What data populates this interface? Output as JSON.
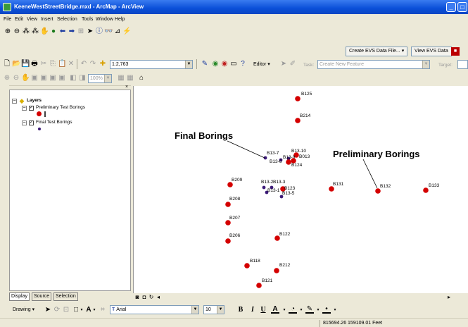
{
  "window": {
    "title": "KeeneWestStreetBridge.mxd - ArcMap - ArcView"
  },
  "menu": [
    "File",
    "Edit",
    "View",
    "Insert",
    "Selection",
    "Tools",
    "Window",
    "Help"
  ],
  "toolbar": {
    "scale": "1:2,763",
    "editor_label": "Editor",
    "task_label": "Task:",
    "task_value": "Create New Feature",
    "target_label": "Target:",
    "zoom_value": "100%",
    "create_evs_label": "Create EVS Data File...",
    "view_evs_label": "View EVS Data"
  },
  "toc": {
    "root_label": "Layers",
    "layers": [
      {
        "name": "Preliminary Test Borings",
        "checked": true,
        "color": "#cc0000"
      },
      {
        "name": "Final Test Borings",
        "checked": true,
        "color": "#3c1a78"
      }
    ]
  },
  "tabs": [
    "Display",
    "Source",
    "Selection"
  ],
  "map": {
    "annotations": {
      "final": "Final Borings",
      "preliminary": "Preliminary Borings"
    },
    "preliminary_color": "#d40000",
    "final_color": "#3c1a78",
    "borings": [
      "B125",
      "B214",
      "B13-7",
      "B13-10",
      "B13-6",
      "B13-9",
      "B013",
      "B124",
      "B209",
      "B13-2",
      "B13-3",
      "B13-1",
      "B123",
      "B13-5",
      "B131",
      "B132",
      "B133",
      "B208",
      "B207",
      "B206",
      "B122",
      "B118",
      "B212",
      "B121"
    ]
  },
  "drawing": {
    "label": "Drawing",
    "font": "Arial",
    "font_size": "10",
    "bold": "B",
    "italic": "I",
    "underline": "U",
    "text_color": "A"
  },
  "status": {
    "coords": "815694.26  159109.01 Feet"
  }
}
